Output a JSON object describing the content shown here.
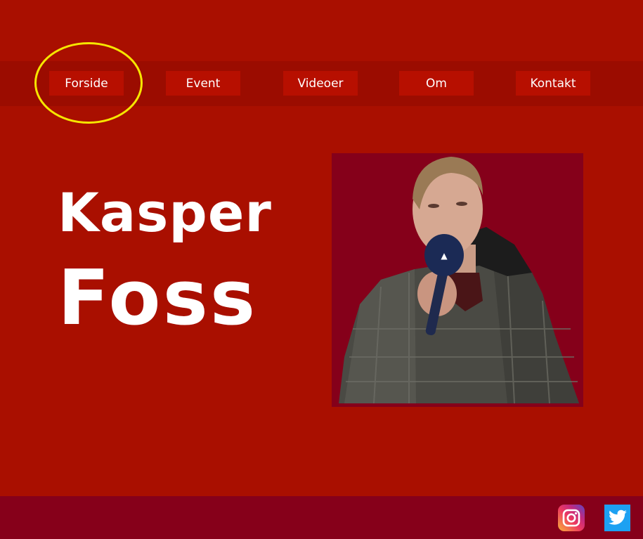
{
  "nav": {
    "items": [
      {
        "label": "Forside",
        "active": true
      },
      {
        "label": "Event"
      },
      {
        "label": "Videoer"
      },
      {
        "label": "Om"
      },
      {
        "label": "Kontakt"
      }
    ]
  },
  "hero": {
    "first_name": "Kasper",
    "last_name": "Foss"
  },
  "photo": {
    "description_icon": "person-with-microphone-photo"
  },
  "footer": {
    "social": [
      {
        "name": "instagram-icon"
      },
      {
        "name": "twitter-icon"
      }
    ]
  },
  "colors": {
    "background": "#a90f00",
    "navbar": "#9b0c00",
    "nav_button": "#b70f00",
    "footer": "#86001a",
    "photo_bg": "#85001a",
    "highlight": "#f6e600"
  }
}
